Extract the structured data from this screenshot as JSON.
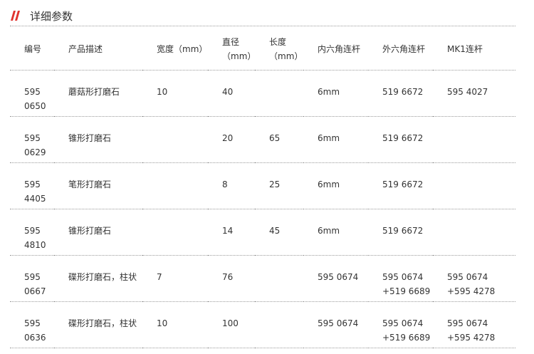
{
  "section": {
    "title": "详细参数",
    "accent_color": "#e0332e"
  },
  "table": {
    "headers": [
      {
        "label": "编号"
      },
      {
        "label": "产品描述"
      },
      {
        "label": "宽度（mm）"
      },
      {
        "label": "直径\n（mm）"
      },
      {
        "label": "长度\n（mm）"
      },
      {
        "label": "内六角连杆"
      },
      {
        "label": "外六角连杆"
      },
      {
        "label": "MK1连杆"
      }
    ],
    "rows": [
      {
        "code": "595\n0650",
        "desc": "蘑菇形打磨石",
        "width": "10",
        "diameter": "40",
        "length": "",
        "hex_inner": "6mm",
        "hex_outer": "519 6672",
        "mk1": "595 4027"
      },
      {
        "code": "595\n0629",
        "desc": "锥形打磨石",
        "width": "",
        "diameter": "20",
        "length": "65",
        "hex_inner": "6mm",
        "hex_outer": "519 6672",
        "mk1": ""
      },
      {
        "code": "595\n4405",
        "desc": "笔形打磨石",
        "width": "",
        "diameter": "8",
        "length": "25",
        "hex_inner": "6mm",
        "hex_outer": "519 6672",
        "mk1": ""
      },
      {
        "code": "595\n4810",
        "desc": "锥形打磨石",
        "width": "",
        "diameter": "14",
        "length": "45",
        "hex_inner": "6mm",
        "hex_outer": "519 6672",
        "mk1": ""
      },
      {
        "code": "595\n0667",
        "desc": "碟形打磨石，柱状",
        "width": "7",
        "diameter": "76",
        "length": "",
        "hex_inner": "595 0674",
        "hex_outer": "595 0674\n+519 6689",
        "mk1": "595 0674\n+595 4278"
      },
      {
        "code": "595\n0636",
        "desc": "碟形打磨石，柱状",
        "width": "10",
        "diameter": "100",
        "length": "",
        "hex_inner": "595 0674",
        "hex_outer": "595 0674\n+519 6689",
        "mk1": "595 0674\n+595 4278"
      }
    ]
  }
}
